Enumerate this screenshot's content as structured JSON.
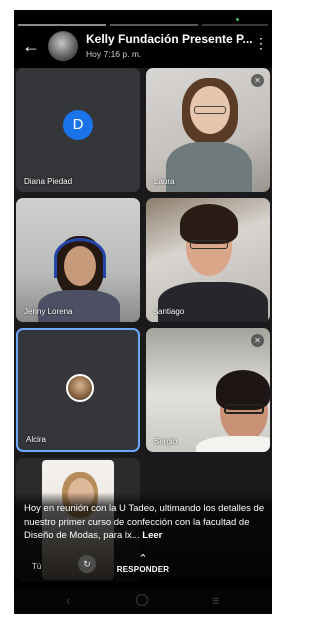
{
  "status": {
    "segments": 3
  },
  "header": {
    "title": "Kelly Fundación Presente P...",
    "subtitle": "Hoy 7:16 p. m."
  },
  "participants": [
    {
      "name": "Diana Piedad",
      "initial": "D",
      "muted": false
    },
    {
      "name": "Laura",
      "muted": true
    },
    {
      "name": "Jenny Lorena",
      "muted": false
    },
    {
      "name": "santiago",
      "muted": false
    },
    {
      "name": "Alcira",
      "muted": false,
      "active_speaker": true
    },
    {
      "name": "Sergio",
      "muted": true
    },
    {
      "name": "Tú",
      "muted": false,
      "self_view": true
    }
  ],
  "caption": {
    "text": "Hoy en reunión con la U Tadeo, ultimando los detalles de nuestro primer curso de confección con la facultad de Diseño de Modas, para lx... ",
    "more": "Leer"
  },
  "reply": {
    "label": "RESPONDER"
  },
  "colors": {
    "accent_blue": "#1a73e8",
    "active_border": "#6ea8ff",
    "tile_bg": "#35363a"
  }
}
